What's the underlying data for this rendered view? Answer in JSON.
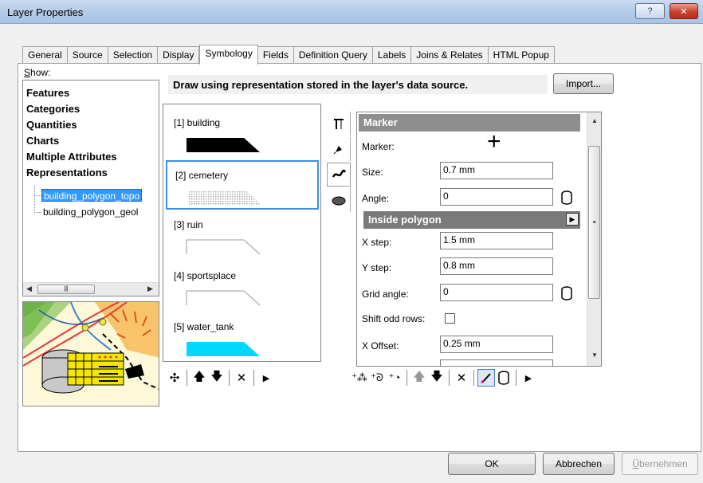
{
  "window": {
    "title": "Layer Properties",
    "help_label": "?",
    "close_label": "✕"
  },
  "tabs": [
    "General",
    "Source",
    "Selection",
    "Display",
    "Symbology",
    "Fields",
    "Definition Query",
    "Labels",
    "Joins & Relates",
    "HTML Popup"
  ],
  "active_tab": "Symbology",
  "show": {
    "label_prefix": "S",
    "label_rest": "how:",
    "items": [
      "Features",
      "Categories",
      "Quantities",
      "Charts",
      "Multiple Attributes",
      "Representations"
    ],
    "tree": [
      "building_polygon_topo",
      "building_polygon_geol"
    ],
    "selected_tree": "building_polygon_topo"
  },
  "banner": "Draw using representation stored in the layer's data source.",
  "import_button": "Import...",
  "rules": [
    {
      "label": "[1] building",
      "swatch": "#000000",
      "style": "solid"
    },
    {
      "label": "[2] cemetery",
      "swatch": "#b0b0b0",
      "style": "dots"
    },
    {
      "label": "[3] ruin",
      "swatch": "#9a9a9a",
      "style": "outline"
    },
    {
      "label": "[4] sportsplace",
      "swatch": "#9a9a9a",
      "style": "outline"
    },
    {
      "label": "[5] water_tank",
      "swatch": "#00d8ff",
      "style": "solid"
    }
  ],
  "selected_rule": "[2] cemetery",
  "properties": {
    "marker_header": "Marker",
    "marker_label": "Marker:",
    "marker_symbol": "+",
    "size_label": "Size:",
    "size_value": "0.7 mm",
    "angle_label": "Angle:",
    "angle_value": "0",
    "inside_header": "Inside polygon",
    "x_step_label": "X step:",
    "x_step_value": "1.5 mm",
    "y_step_label": "Y step:",
    "y_step_value": "0.8 mm",
    "grid_angle_label": "Grid angle:",
    "grid_angle_value": "0",
    "shift_label": "Shift odd rows:",
    "shift_checked": false,
    "x_offset_label": "X Offset:",
    "x_offset_value": "0.25 mm"
  },
  "footer": {
    "ok": "OK",
    "cancel": "Abbrechen",
    "apply_prefix": "Ü",
    "apply_rest": "bernehmen"
  },
  "colors": {
    "selection": "#3399ff",
    "section_header": "#8e8e8e",
    "water": "#00d8ff"
  }
}
